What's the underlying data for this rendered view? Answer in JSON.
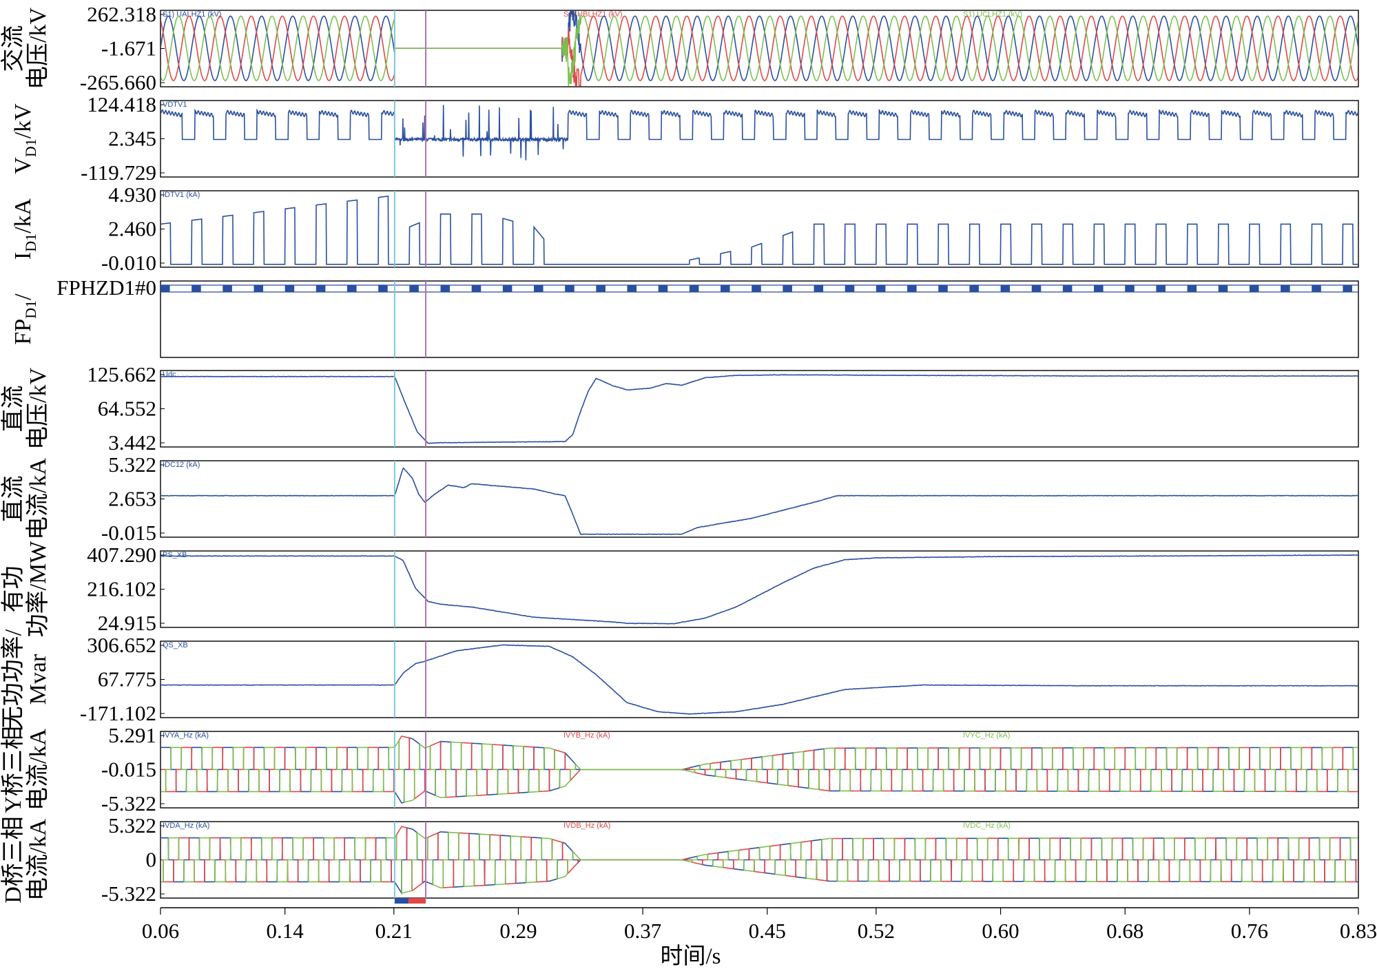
{
  "chart_data": {
    "type": "line",
    "xlim": [
      0.06,
      0.83
    ],
    "xticks": [
      "0.06",
      "0.14",
      "0.21",
      "0.29",
      "0.37",
      "0.45",
      "0.52",
      "0.60",
      "0.68",
      "0.76",
      "0.83"
    ],
    "xlabel": "时间/s",
    "markers": [
      {
        "name": "cursor-1",
        "x": 0.2105,
        "color": "#7ec8d8"
      },
      {
        "name": "cursor-2",
        "x": 0.2305,
        "color": "#b070b8"
      }
    ],
    "colors": {
      "blue": "#2a4fa0",
      "red": "#e04848",
      "green": "#7cc050",
      "frame": "#000000"
    },
    "panels": [
      {
        "id": "ac-voltage",
        "ylabel": [
          "交流",
          "电压/kV"
        ],
        "yticks": [
          "262.318",
          "-1.671",
          "-265.660"
        ],
        "ylim": [
          -265.66,
          262.318
        ],
        "legend": [
          "S1) UALHZ1 (kV)",
          "S1) UBLHZ1 (kV)",
          "S1) UCLHZ1 (kV)"
        ],
        "series": [
          {
            "name": "S1) UALHZ1 (kV)",
            "color": "blue",
            "kind": "sine3",
            "phase": 0,
            "amplitude": 240,
            "segments": [
              [
                0.06,
                0.2105,
                1.0
              ],
              [
                0.2105,
                0.322,
                0.0
              ],
              [
                0.322,
                0.83,
                1.0
              ]
            ]
          },
          {
            "name": "S1) UBLHZ1 (kV)",
            "color": "red",
            "kind": "sine3",
            "phase": 2.094,
            "amplitude": 240,
            "segments": [
              [
                0.06,
                0.2105,
                1.0
              ],
              [
                0.2105,
                0.322,
                0.0
              ],
              [
                0.322,
                0.83,
                1.0
              ]
            ]
          },
          {
            "name": "S1) UCLHZ1 (kV)",
            "color": "green",
            "kind": "sine3",
            "phase": 4.189,
            "amplitude": 240,
            "segments": [
              [
                0.06,
                0.2105,
                1.0
              ],
              [
                0.2105,
                0.322,
                0.0
              ],
              [
                0.322,
                0.83,
                1.0
              ]
            ]
          }
        ]
      },
      {
        "id": "valve-voltage",
        "ylabel": [
          "V_D1/kV"
        ],
        "yticks": [
          "124.418",
          "2.345",
          "-119.729"
        ],
        "ylim": [
          -119.729,
          124.418
        ],
        "legend": [
          "VDTV1"
        ],
        "series": [
          {
            "name": "VDTV1",
            "color": "blue",
            "kind": "pulse",
            "high": 95,
            "low": 0,
            "period": 0.02,
            "duty": 0.6,
            "faultStart": 0.2105,
            "faultEnd": 0.322
          }
        ]
      },
      {
        "id": "valve-current",
        "ylabel": [
          "I_D1/kA"
        ],
        "yticks": [
          "4.930",
          "2.460",
          "-0.010"
        ],
        "ylim": [
          -0.01,
          4.93
        ],
        "legend": [
          "IDTV1 (kA)"
        ],
        "series": [
          {
            "name": "IDTV1 (kA)",
            "color": "blue",
            "kind": "block",
            "period": 0.02,
            "width": 0.0065,
            "levels": [
              [
                0.06,
                2.8
              ],
              [
                0.2105,
                4.8
              ],
              [
                0.22,
                2.6
              ],
              [
                0.24,
                3.5
              ],
              [
                0.27,
                3.5
              ],
              [
                0.3,
                2.6
              ],
              [
                0.32,
                0.0
              ],
              [
                0.39,
                0.0
              ],
              [
                0.4,
                0.3
              ],
              [
                0.44,
                1.2
              ],
              [
                0.48,
                2.8
              ],
              [
                0.83,
                2.8
              ]
            ]
          }
        ]
      },
      {
        "id": "firing-pulse",
        "ylabel": [
          "FP_D1"
        ],
        "yticks": [
          "FPHZD1#0"
        ],
        "ylim": [
          0,
          1
        ],
        "legend": [],
        "series": [
          {
            "name": "FPHZD1#0",
            "color": "blue",
            "kind": "firing",
            "period": 0.02,
            "width": 0.006
          }
        ]
      },
      {
        "id": "dc-voltage",
        "ylabel": [
          "直流",
          "电压/kV"
        ],
        "yticks": [
          "125.662",
          "64.552",
          "3.442"
        ],
        "ylim": [
          3.442,
          125.662
        ],
        "legend": [
          "Udc"
        ],
        "series": [
          {
            "name": "Udc",
            "color": "blue",
            "kind": "curve",
            "points": [
              [
                0.06,
                120
              ],
              [
                0.2105,
                120
              ],
              [
                0.218,
                70
              ],
              [
                0.225,
                25
              ],
              [
                0.232,
                5
              ],
              [
                0.24,
                6
              ],
              [
                0.32,
                8
              ],
              [
                0.325,
                20
              ],
              [
                0.33,
                60
              ],
              [
                0.335,
                95
              ],
              [
                0.34,
                117
              ],
              [
                0.35,
                105
              ],
              [
                0.36,
                97
              ],
              [
                0.375,
                100
              ],
              [
                0.385,
                108
              ],
              [
                0.395,
                105
              ],
              [
                0.41,
                118
              ],
              [
                0.43,
                122
              ],
              [
                0.46,
                123
              ],
              [
                0.55,
                122
              ],
              [
                0.65,
                121
              ],
              [
                0.83,
                121
              ]
            ]
          }
        ]
      },
      {
        "id": "dc-current",
        "ylabel": [
          "直流",
          "电流/kA"
        ],
        "yticks": [
          "5.322",
          "2.653",
          "-0.015"
        ],
        "ylim": [
          -0.015,
          5.322
        ],
        "legend": [
          "IDC12 (kA)"
        ],
        "series": [
          {
            "name": "IDC12 (kA)",
            "color": "blue",
            "kind": "curve",
            "points": [
              [
                0.06,
                2.9
              ],
              [
                0.2105,
                2.9
              ],
              [
                0.216,
                5.0
              ],
              [
                0.222,
                4.2
              ],
              [
                0.226,
                3.0
              ],
              [
                0.23,
                2.4
              ],
              [
                0.236,
                3.0
              ],
              [
                0.245,
                3.7
              ],
              [
                0.255,
                3.5
              ],
              [
                0.26,
                3.8
              ],
              [
                0.28,
                3.6
              ],
              [
                0.3,
                3.4
              ],
              [
                0.315,
                3.0
              ],
              [
                0.32,
                2.9
              ],
              [
                0.325,
                1.5
              ],
              [
                0.33,
                0.0
              ],
              [
                0.395,
                0.0
              ],
              [
                0.405,
                0.5
              ],
              [
                0.44,
                1.2
              ],
              [
                0.48,
                2.4
              ],
              [
                0.495,
                2.9
              ],
              [
                0.83,
                2.9
              ]
            ]
          }
        ]
      },
      {
        "id": "active-power",
        "ylabel": [
          "有功",
          "功率/MW"
        ],
        "yticks": [
          "407.290",
          "216.102",
          "24.915"
        ],
        "ylim": [
          24.915,
          407.29
        ],
        "legend": [
          "PS_XB"
        ],
        "series": [
          {
            "name": "PS_XB",
            "color": "blue",
            "kind": "curve",
            "points": [
              [
                0.06,
                395
              ],
              [
                0.2105,
                395
              ],
              [
                0.216,
                370
              ],
              [
                0.224,
                220
              ],
              [
                0.232,
                150
              ],
              [
                0.24,
                135
              ],
              [
                0.26,
                120
              ],
              [
                0.3,
                65
              ],
              [
                0.35,
                40
              ],
              [
                0.36,
                32
              ],
              [
                0.39,
                30
              ],
              [
                0.41,
                60
              ],
              [
                0.43,
                120
              ],
              [
                0.46,
                250
              ],
              [
                0.48,
                330
              ],
              [
                0.5,
                375
              ],
              [
                0.52,
                385
              ],
              [
                0.6,
                392
              ],
              [
                0.7,
                395
              ],
              [
                0.83,
                400
              ]
            ]
          }
        ]
      },
      {
        "id": "reactive-power",
        "ylabel": [
          "无功功率/",
          "Mvar"
        ],
        "yticks": [
          "306.652",
          "67.775",
          "-171.102"
        ],
        "ylim": [
          -171.102,
          306.652
        ],
        "legend": [
          "QS_XB"
        ],
        "series": [
          {
            "name": "QS_XB",
            "color": "blue",
            "kind": "curve",
            "points": [
              [
                0.06,
                30
              ],
              [
                0.2105,
                30
              ],
              [
                0.216,
                110
              ],
              [
                0.224,
                175
              ],
              [
                0.23,
                190
              ],
              [
                0.25,
                260
              ],
              [
                0.28,
                300
              ],
              [
                0.31,
                290
              ],
              [
                0.325,
                220
              ],
              [
                0.34,
                100
              ],
              [
                0.36,
                -90
              ],
              [
                0.38,
                -150
              ],
              [
                0.4,
                -165
              ],
              [
                0.43,
                -150
              ],
              [
                0.46,
                -100
              ],
              [
                0.5,
                0
              ],
              [
                0.55,
                30
              ],
              [
                0.65,
                25
              ],
              [
                0.83,
                25
              ]
            ]
          }
        ]
      },
      {
        "id": "y-bridge-current",
        "ylabel": [
          "Y桥三相",
          "电流/kA"
        ],
        "yticks": [
          "5.291",
          "-0.015",
          "-5.322"
        ],
        "ylim": [
          -5.322,
          5.291
        ],
        "legend": [
          "IVYA_Hz (kA)",
          "IVYB_Hz (kA)",
          "IVYC_Hz (kA)"
        ],
        "series": [
          {
            "name": "IVYA_Hz (kA)",
            "color": "blue",
            "kind": "square3",
            "phase": 0
          },
          {
            "name": "IVYB_Hz (kA)",
            "color": "red",
            "kind": "square3",
            "phase": 2.094
          },
          {
            "name": "IVYC_Hz (kA)",
            "color": "green",
            "kind": "square3",
            "phase": 4.189
          }
        ],
        "envelope": [
          [
            0.06,
            3.3
          ],
          [
            0.2105,
            3.3
          ],
          [
            0.215,
            5.0
          ],
          [
            0.222,
            4.6
          ],
          [
            0.23,
            3.2
          ],
          [
            0.24,
            4.2
          ],
          [
            0.27,
            3.8
          ],
          [
            0.31,
            3.2
          ],
          [
            0.32,
            2.5
          ],
          [
            0.33,
            0.0
          ],
          [
            0.395,
            0.0
          ],
          [
            0.41,
            0.8
          ],
          [
            0.45,
            2.0
          ],
          [
            0.49,
            3.2
          ],
          [
            0.83,
            3.3
          ]
        ]
      },
      {
        "id": "d-bridge-current",
        "ylabel": [
          "D桥三相",
          "电流/kA"
        ],
        "yticks": [
          "5.322",
          "0",
          "-5.322"
        ],
        "ylim": [
          -5.322,
          5.322
        ],
        "legend": [
          "IVDA_Hz (kA)",
          "IVDB_Hz (kA)",
          "IVDC_Hz (kA)"
        ],
        "series": [
          {
            "name": "IVDA_Hz (kA)",
            "color": "blue",
            "kind": "square3",
            "phase": 0.52
          },
          {
            "name": "IVDB_Hz (kA)",
            "color": "red",
            "kind": "square3",
            "phase": 2.61
          },
          {
            "name": "IVDC_Hz (kA)",
            "color": "green",
            "kind": "square3",
            "phase": 4.71
          }
        ],
        "envelope": [
          [
            0.06,
            3.3
          ],
          [
            0.2105,
            3.3
          ],
          [
            0.215,
            5.0
          ],
          [
            0.222,
            4.6
          ],
          [
            0.23,
            3.2
          ],
          [
            0.24,
            4.2
          ],
          [
            0.27,
            3.8
          ],
          [
            0.31,
            3.2
          ],
          [
            0.32,
            2.5
          ],
          [
            0.33,
            0.0
          ],
          [
            0.395,
            0.0
          ],
          [
            0.41,
            0.8
          ],
          [
            0.45,
            2.0
          ],
          [
            0.49,
            3.2
          ],
          [
            0.83,
            3.3
          ]
        ]
      }
    ]
  }
}
